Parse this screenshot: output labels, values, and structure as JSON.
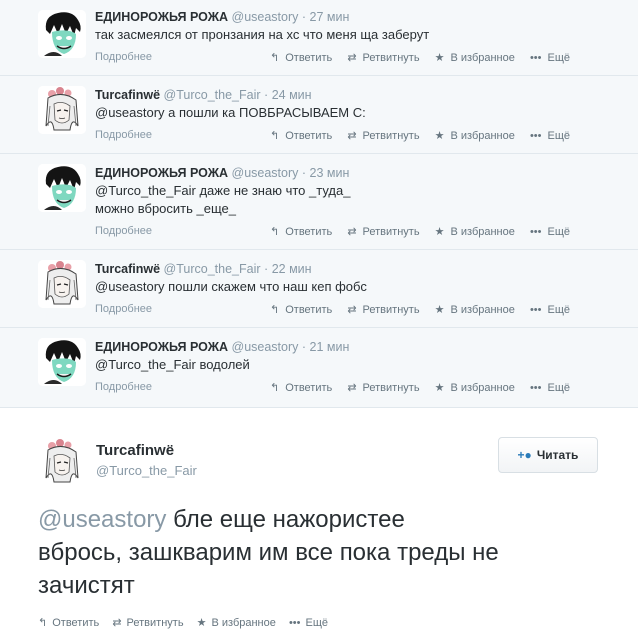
{
  "tweets": [
    {
      "name": "ЕДИНОРОЖЬЯ РОЖА",
      "handle": "@useastory",
      "sep": "·",
      "time": "27 мин",
      "text_line1": "так засмеялся от пронзания на хс что меня ща заберут",
      "text_line2": "",
      "details": "Подробнее"
    },
    {
      "name": "Turcafinwë",
      "handle": "@Turco_the_Fair",
      "sep": "·",
      "time": "24 мин",
      "text_line1": "@useastory а пошли ка ПОВБРАСЫВАЕМ С:",
      "text_line2": "",
      "details": "Подробнее"
    },
    {
      "name": "ЕДИНОРОЖЬЯ РОЖА",
      "handle": "@useastory",
      "sep": "·",
      "time": "23 мин",
      "text_line1": "@Turco_the_Fair даже не знаю что _туда_",
      "text_line2": "можно вбросить _еще_",
      "details": "Подробнее"
    },
    {
      "name": "Turcafinwë",
      "handle": "@Turco_the_Fair",
      "sep": "·",
      "time": "22 мин",
      "text_line1": "@useastory пошли скажем что наш кеп фобс",
      "text_line2": "",
      "details": "Подробнее"
    },
    {
      "name": "ЕДИНОРОЖЬЯ РОЖА",
      "handle": "@useastory",
      "sep": "·",
      "time": "21 мин",
      "text_line1": "@Turco_the_Fair водолей",
      "text_line2": "",
      "details": "Подробнее"
    }
  ],
  "actions": {
    "reply": "Ответить",
    "retweet": "Ретвитнуть",
    "favorite": "В избранное",
    "more": "Ещё"
  },
  "icons": {
    "reply": "reply-icon",
    "retweet": "retweet-icon",
    "favorite": "star-icon",
    "more": "more-dots-icon",
    "follow": "add-user-icon"
  },
  "expanded": {
    "name": "Turcafinwë",
    "handle": "@Turco_the_Fair",
    "follow_label": "Читать",
    "mention": "@useastory",
    "text_line1_rest": " бле еще нажористее",
    "text_line2": "вбрось, зашкварим им все пока треды не",
    "text_line3": "зачистят"
  },
  "colors": {
    "tweet_bg": "#f5f8fa",
    "muted": "#8899a6",
    "text": "#292f33",
    "accent": "#2b7bb9"
  }
}
